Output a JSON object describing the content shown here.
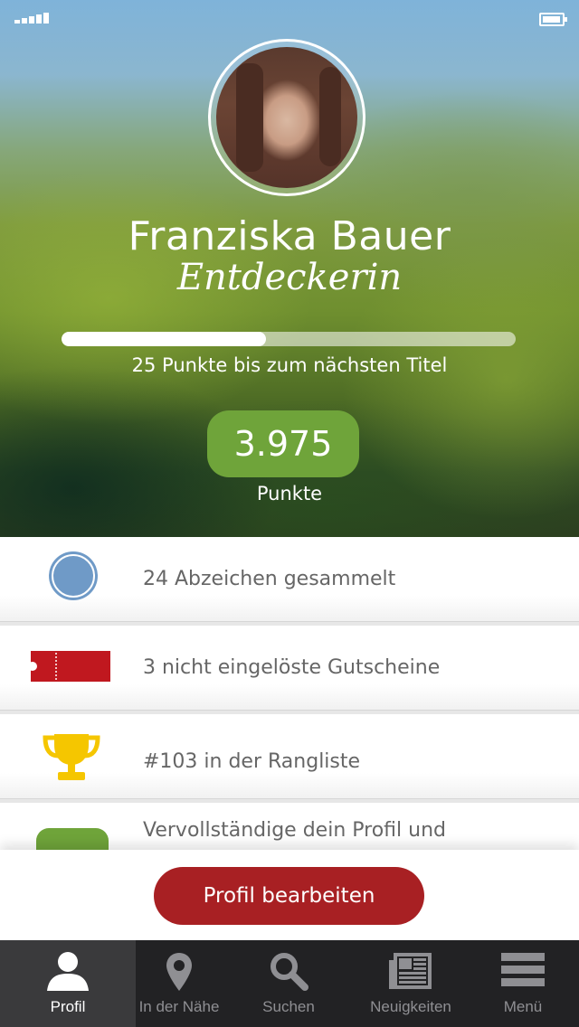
{
  "profile": {
    "name": "Franziska Bauer",
    "title": "Entdeckerin",
    "progress_fraction": 0.45,
    "progress_text": "25 Punkte bis zum nächsten Titel",
    "points": "3.975",
    "points_label": "Punkte"
  },
  "list": {
    "items": [
      {
        "label": "24 Abzeichen gesammelt",
        "icon": "badge-icon",
        "color": "#6f9ac7"
      },
      {
        "label": "3 nicht eingelöste Gutscheine",
        "icon": "voucher-icon",
        "color": "#c0181f"
      },
      {
        "label": "#103 in der Rangliste",
        "icon": "trophy-icon",
        "color": "#f5c600"
      },
      {
        "label": "Vervollständige dein Profil und",
        "icon": "profile-complete-icon",
        "color": "#6fa43a"
      }
    ]
  },
  "actions": {
    "edit_profile": "Profil bearbeiten"
  },
  "tabbar": {
    "tabs": [
      {
        "label": "Profil",
        "icon": "person-icon",
        "active": true
      },
      {
        "label": "In der Nähe",
        "icon": "location-pin-icon",
        "active": false
      },
      {
        "label": "Suchen",
        "icon": "search-icon",
        "active": false
      },
      {
        "label": "Neuigkeiten",
        "icon": "newspaper-icon",
        "active": false
      },
      {
        "label": "Menü",
        "icon": "menu-icon",
        "active": false
      }
    ]
  },
  "colors": {
    "accent_green": "#6fa43a",
    "button_red": "#a82023",
    "tabbar_bg": "#222224"
  }
}
